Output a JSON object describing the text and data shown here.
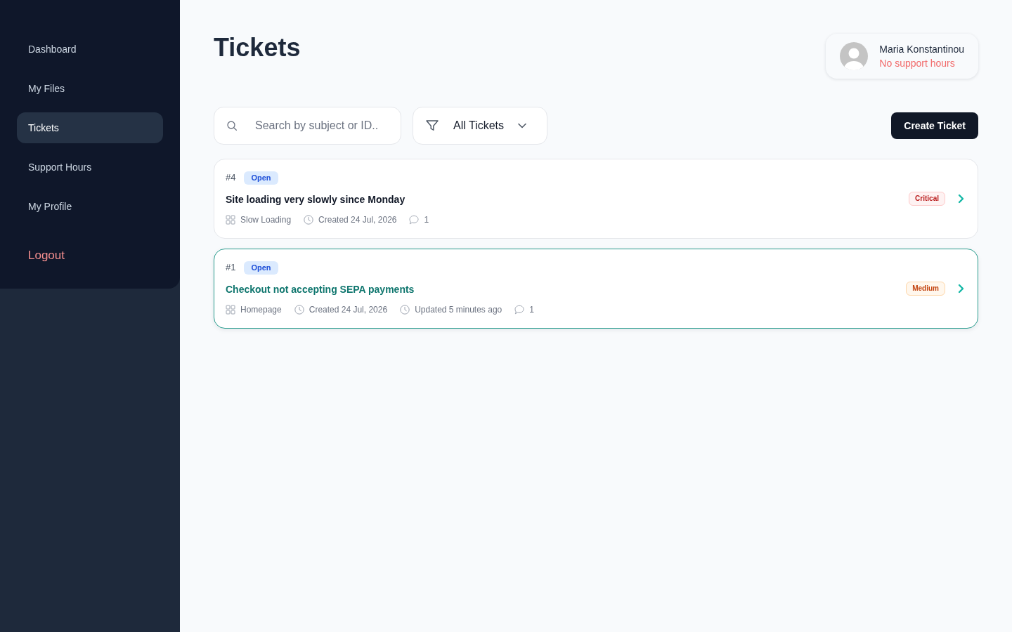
{
  "sidebar": {
    "items": [
      {
        "label": "Dashboard",
        "selected": false
      },
      {
        "label": "My Files",
        "selected": false
      },
      {
        "label": "Tickets",
        "selected": true
      },
      {
        "label": "Support Hours",
        "selected": false
      },
      {
        "label": "My Profile",
        "selected": false
      }
    ],
    "logout": "Logout"
  },
  "header": {
    "title": "Tickets"
  },
  "user": {
    "name": "Maria Konstantinou",
    "status": "No support hours"
  },
  "toolbar": {
    "search": {
      "placeholder": "Search by subject or ID.."
    },
    "filter": {
      "value": "All Tickets"
    },
    "create_button": "Create Ticket"
  },
  "tickets": [
    {
      "id": "#4",
      "status": "Open",
      "title": "Site loading very slowly since Monday",
      "selected": false,
      "priority": {
        "label": "Critical",
        "kind": "critical"
      },
      "meta": [
        {
          "kind": "category",
          "text": "Slow Loading"
        },
        {
          "kind": "created",
          "text": "Created 24 Jul, 2026"
        },
        {
          "kind": "comments",
          "text": "1"
        }
      ]
    },
    {
      "id": "#1",
      "status": "Open",
      "title": "Checkout not accepting SEPA payments",
      "selected": true,
      "priority": {
        "label": "Medium",
        "kind": "medium"
      },
      "meta": [
        {
          "kind": "category",
          "text": "Homepage"
        },
        {
          "kind": "created",
          "text": "Created 24 Jul, 2026"
        },
        {
          "kind": "updated",
          "text": "Updated 5 minutes ago"
        },
        {
          "kind": "comments",
          "text": "1"
        }
      ]
    }
  ]
}
